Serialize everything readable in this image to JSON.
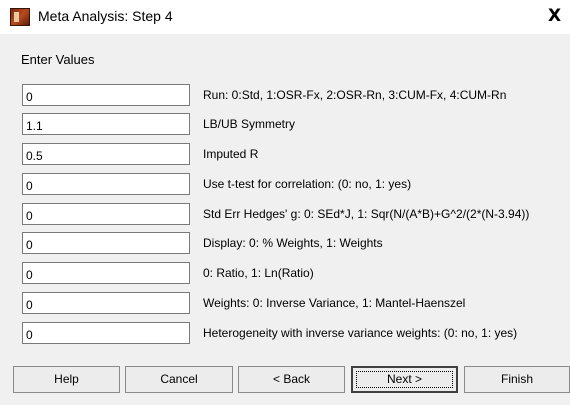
{
  "window": {
    "title": "Meta Analysis: Step 4",
    "close_glyph": "X"
  },
  "section_label": "Enter Values",
  "fields": [
    {
      "value": "0",
      "label": "Run: 0:Std, 1:OSR-Fx, 2:OSR-Rn, 3:CUM-Fx, 4:CUM-Rn"
    },
    {
      "value": "1.1",
      "label": "LB/UB Symmetry"
    },
    {
      "value": "0.5",
      "label": "Imputed R"
    },
    {
      "value": "0",
      "label": "Use t-test for correlation: (0: no, 1: yes)"
    },
    {
      "value": "0",
      "label": "Std Err Hedges' g: 0: SEd*J, 1: Sqr(N/(A*B)+G^2/(2*(N-3.94))"
    },
    {
      "value": "0",
      "label": "Display: 0: % Weights, 1: Weights"
    },
    {
      "value": "0",
      "label": "0: Ratio, 1: Ln(Ratio)"
    },
    {
      "value": "0",
      "label": "Weights: 0: Inverse Variance, 1: Mantel-Haenszel"
    },
    {
      "value": "0",
      "label": "Heterogeneity with inverse variance weights: (0: no, 1: yes)"
    }
  ],
  "buttons": {
    "help": "Help",
    "cancel": "Cancel",
    "back": "< Back",
    "next": "Next >",
    "finish": "Finish"
  }
}
